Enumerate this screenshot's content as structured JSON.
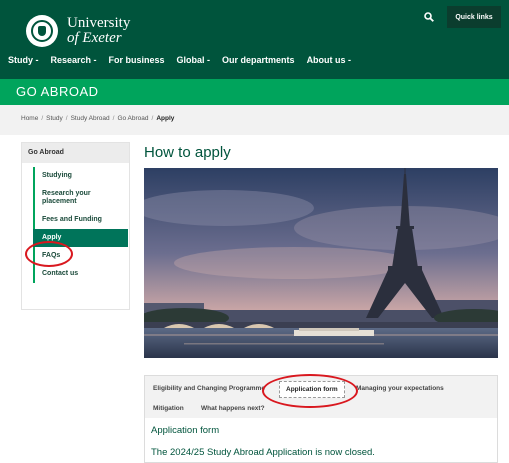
{
  "header": {
    "logo_line1": "University",
    "logo_line2": "of Exeter",
    "quick_links": "Quick links",
    "icons": {
      "search": "search-icon",
      "crest": "university-crest-icon"
    },
    "nav": [
      "Study -",
      "Research -",
      "For business",
      "Global -",
      "Our departments",
      "About us -"
    ]
  },
  "section_title": "GO ABROAD",
  "breadcrumb": {
    "items": [
      "Home",
      "Study",
      "Study Abroad",
      "Go Abroad"
    ],
    "separator": "/",
    "current": "Apply"
  },
  "sidebar": {
    "heading": "Go Abroad",
    "items": [
      "Studying",
      "Research your placement",
      "Fees and Funding",
      "Apply",
      "FAQs",
      "Contact us"
    ],
    "active_index": 3
  },
  "main": {
    "title": "How to apply",
    "hero_image": "Eiffel Tower at dusk over the Seine, Paris"
  },
  "tabs": {
    "items": [
      "Eligibility and Changing Programme",
      "Application form",
      "Managing your expectations",
      "Mitigation",
      "What happens next?"
    ],
    "active_index": 1,
    "content_title": "Application form",
    "content_text": "The 2024/25 Study Abroad Application is now closed."
  },
  "colors": {
    "header_green": "#00543c",
    "band_green": "#00a45c",
    "annotation_red": "#d9181f"
  }
}
